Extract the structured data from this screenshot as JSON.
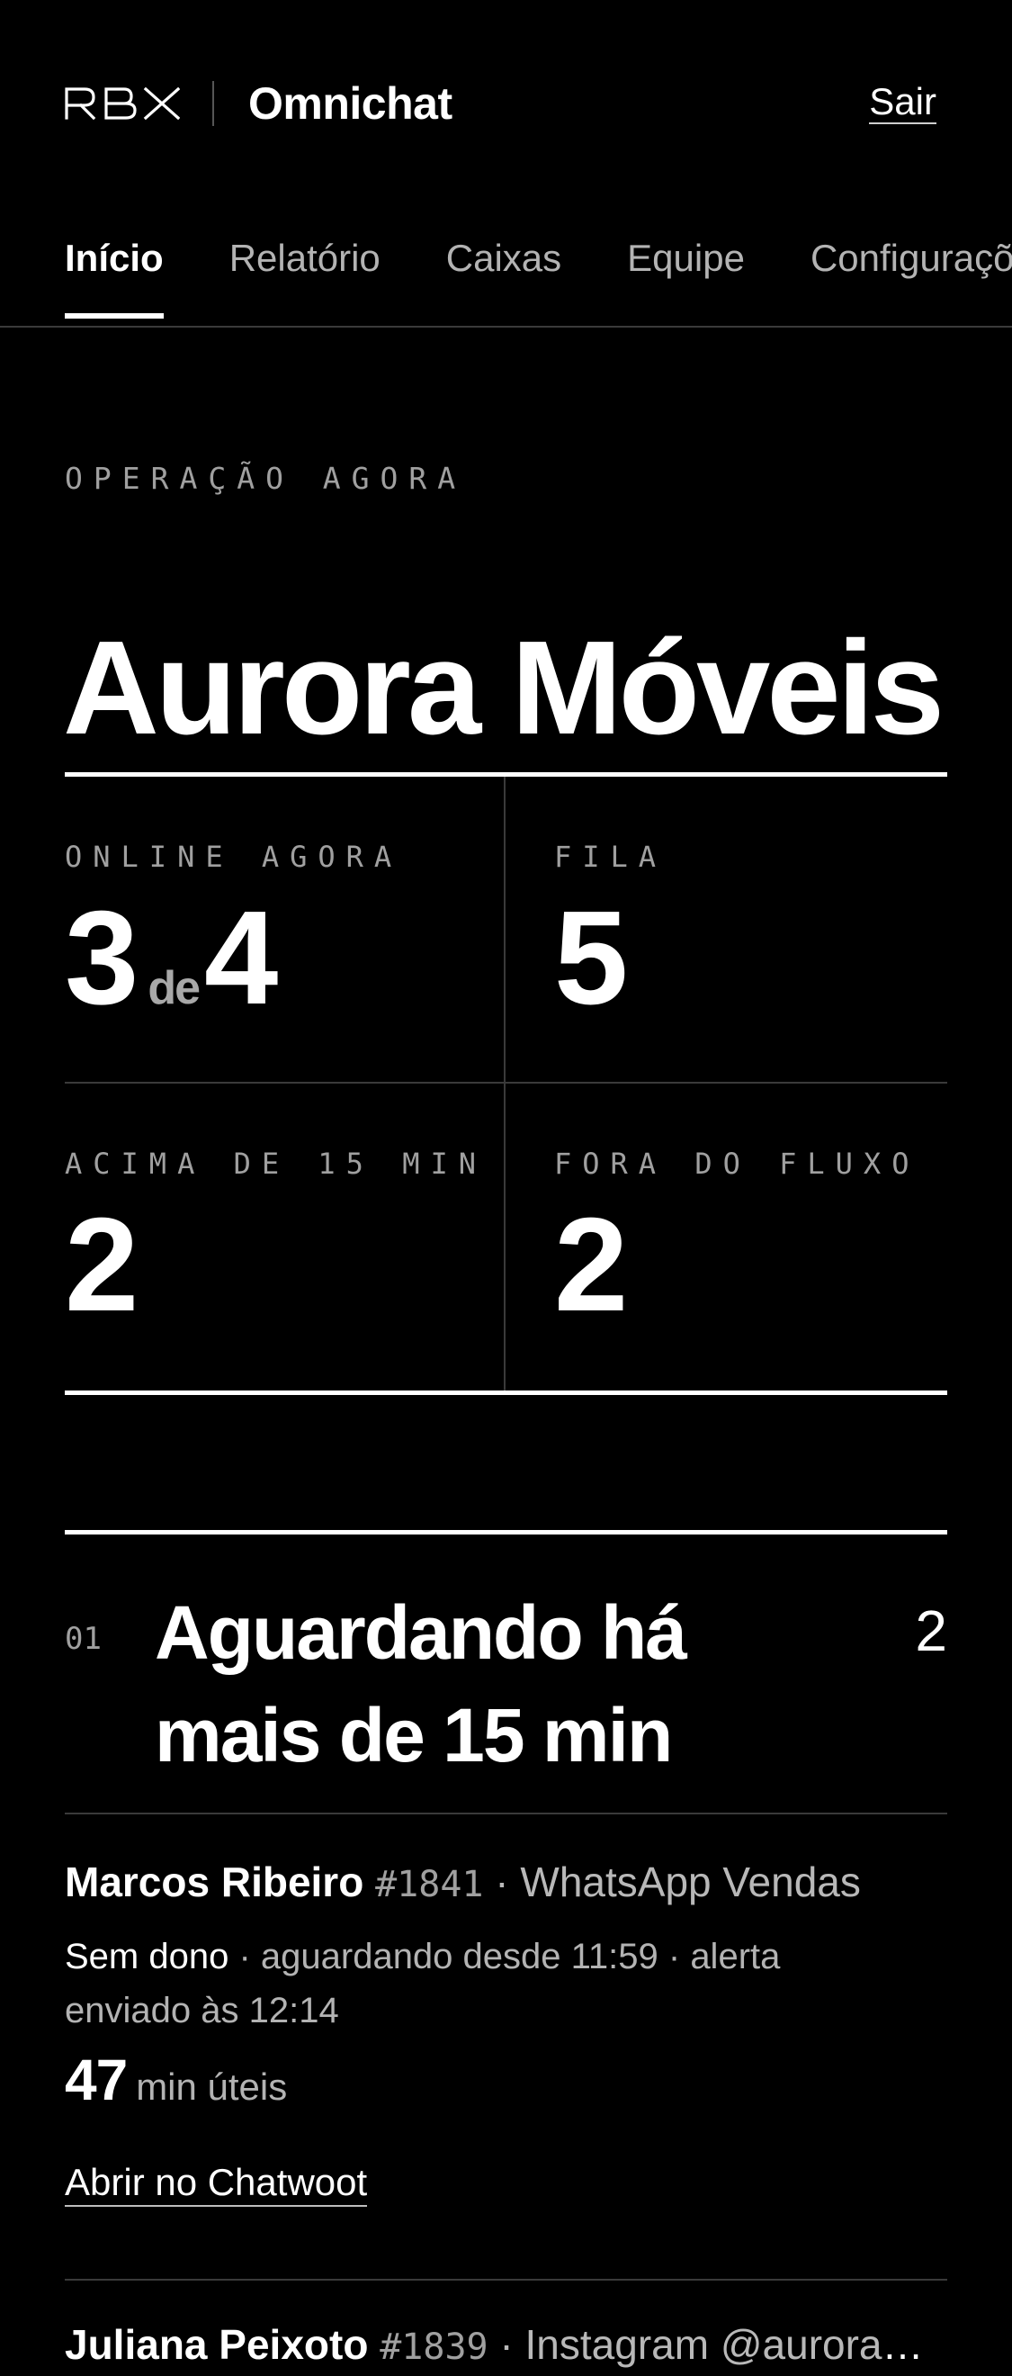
{
  "header": {
    "logo_text": "RBX",
    "app_name": "Omnichat",
    "logout_label": "Sair"
  },
  "tabs": [
    {
      "label": "Início",
      "active": true
    },
    {
      "label": "Relatório",
      "active": false
    },
    {
      "label": "Caixas",
      "active": false
    },
    {
      "label": "Equipe",
      "active": false
    },
    {
      "label": "Configurações",
      "active": false
    }
  ],
  "hero": {
    "eyebrow": "OPERAÇÃO AGORA",
    "title": "Aurora Móveis"
  },
  "stats": {
    "online": {
      "label": "ONLINE AGORA",
      "value": "3",
      "connector": "de",
      "total": "4"
    },
    "queue": {
      "label": "FILA",
      "value": "5"
    },
    "over15": {
      "label": "ACIMA DE 15 MIN",
      "value": "2"
    },
    "offflow": {
      "label": "FORA DO FLUXO",
      "value": "2"
    }
  },
  "section": {
    "number": "01",
    "title": "Aguardando há mais de 15 min",
    "count": "2"
  },
  "conversations": [
    {
      "name": "Marcos Ribeiro",
      "id": "#1841",
      "inbox": "· WhatsApp Vendas",
      "owner": "Sem dono",
      "meta": " · aguardando desde 11:59 · alerta enviado às 12:14",
      "minutes": "47",
      "minutes_unit": "min úteis",
      "link_label": "Abrir no Chatwoot"
    },
    {
      "name": "Juliana Peixoto",
      "id": "#1839",
      "inbox": "· Instagram @auroramoveis"
    }
  ],
  "colors": {
    "background": "#000000",
    "text": "#ffffff",
    "muted": "#a0a0a0",
    "divider": "#3a3a3a"
  }
}
